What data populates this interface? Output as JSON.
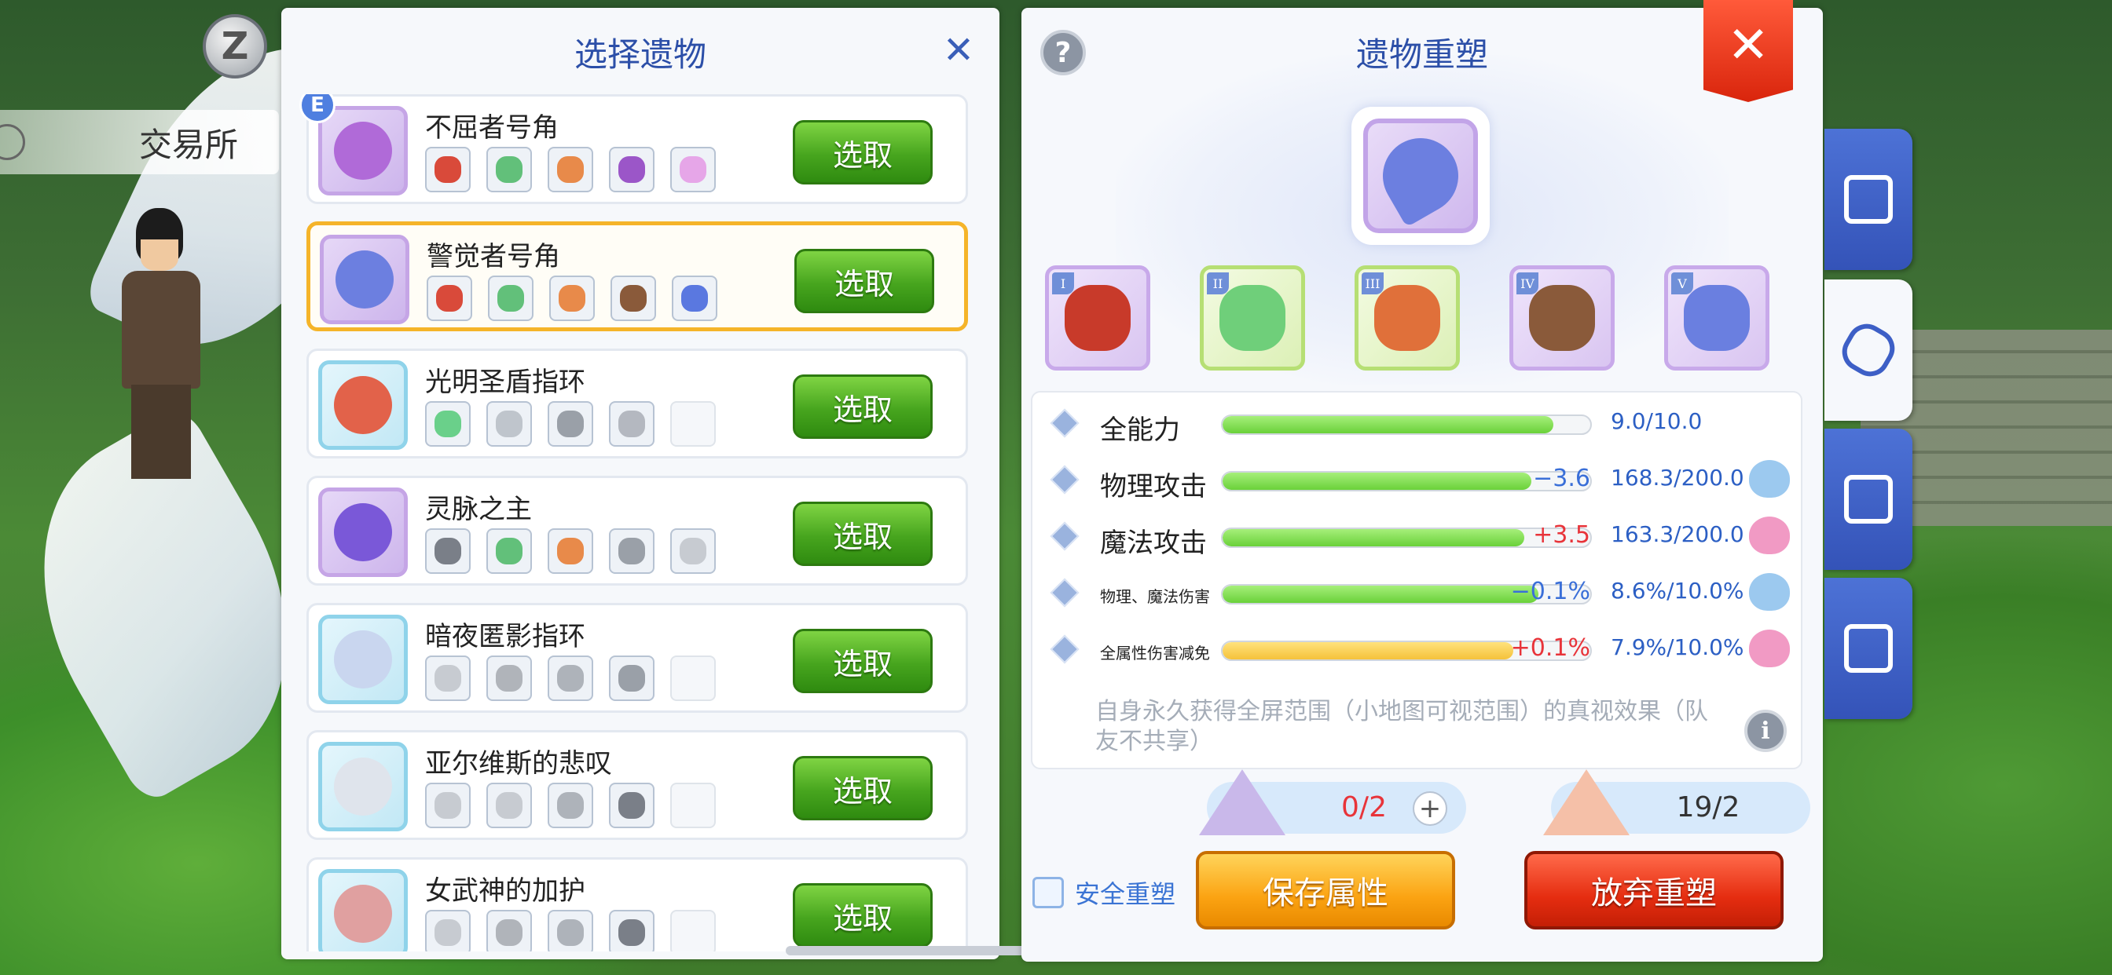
{
  "left_panel": {
    "title": "选择遗物",
    "close_icon": "close-x-icon",
    "select_label": "选取",
    "items": [
      {
        "name": "不屈者号角",
        "badge": "E",
        "frame": "purple",
        "icon_color": "#b06ad8",
        "slots": [
          "#d94a3a",
          "#62c07a",
          "#e88a4a",
          "#9b56c8",
          "#e6a6e8"
        ],
        "selected": false
      },
      {
        "name": "警觉者号角",
        "frame": "purple",
        "icon_color": "#6c7fe0",
        "slots": [
          "#d94a3a",
          "#62c07a",
          "#e88a4a",
          "#8a5a3a",
          "#5a78e0"
        ],
        "selected": true
      },
      {
        "name": "光明圣盾指环",
        "frame": "blue",
        "icon_color": "#e2624a",
        "slots": [
          "#6ad08a",
          "#bfc5cc",
          "#9aa0a8",
          "#b4b8c0",
          ""
        ],
        "selected": false
      },
      {
        "name": "灵脉之主",
        "frame": "purple",
        "icon_color": "#7a58d8",
        "slots": [
          "#7a7f88",
          "#62c07a",
          "#e88a4a",
          "#9aa0a8",
          "#c7cbd1"
        ],
        "selected": false
      },
      {
        "name": "暗夜匿影指环",
        "frame": "blue",
        "icon_color": "#c9d6ef",
        "slots": [
          "#c7cbd1",
          "#b0b4ba",
          "#aeb3ba",
          "#9aa0a8",
          ""
        ],
        "selected": false
      },
      {
        "name": "亚尔维斯的悲叹",
        "frame": "blue",
        "icon_color": "#dfe4ec",
        "slots": [
          "#c7cbd1",
          "#c7cbd1",
          "#aeb3ba",
          "#7a7f88",
          ""
        ],
        "selected": false
      },
      {
        "name": "女武神的加护",
        "frame": "blue",
        "icon_color": "#e0a0a0",
        "slots": [
          "#c7cbd1",
          "#b0b4ba",
          "#aeb3ba",
          "#7a7f88",
          ""
        ],
        "selected": false
      }
    ]
  },
  "right_panel": {
    "title": "遗物重塑",
    "help_label": "?",
    "parts": [
      {
        "roman": "I",
        "color": "#c83a2a",
        "frame": "purple"
      },
      {
        "roman": "II",
        "color": "#6fcf7a",
        "frame": "green"
      },
      {
        "roman": "III",
        "color": "#e0703a",
        "frame": "green"
      },
      {
        "roman": "IV",
        "color": "#8a5a3a",
        "frame": "purple"
      },
      {
        "roman": "V",
        "color": "#6a7fe0",
        "frame": "purple"
      }
    ],
    "stats": [
      {
        "roman": "I",
        "name": "全能力",
        "small": false,
        "fill": 0.9,
        "bar": "green",
        "delta": "",
        "delta_color": "",
        "value": "9.0/10.0",
        "poring": ""
      },
      {
        "roman": "II",
        "name": "物理攻击",
        "small": false,
        "fill": 0.84,
        "bar": "green",
        "delta": "−3.6",
        "delta_color": "#3a6fd8",
        "value": "168.3/200.0",
        "poring": "blue"
      },
      {
        "roman": "III",
        "name": "魔法攻击",
        "small": false,
        "fill": 0.82,
        "bar": "green",
        "delta": "+3.5",
        "delta_color": "#e8343a",
        "value": "163.3/200.0",
        "poring": "pink"
      },
      {
        "roman": "IV",
        "name": "物理、魔法伤害",
        "small": true,
        "fill": 0.86,
        "bar": "green",
        "delta": "−0.1%",
        "delta_color": "#3a6fd8",
        "value": "8.6%/10.0%",
        "poring": "blue"
      },
      {
        "roman": "V",
        "name": "全属性伤害减免",
        "small": true,
        "fill": 0.79,
        "bar": "yellow",
        "delta": "+0.1%",
        "delta_color": "#e8343a",
        "value": "7.9%/10.0%",
        "poring": "pink"
      }
    ],
    "description": "自身永久获得全屏范围（小地图可视范围）的真视效果（队友不共享）",
    "costs": [
      {
        "value": "0/2",
        "color": "#e8343a",
        "pile": "#c9b8ea",
        "has_plus": true
      },
      {
        "value": "19/2",
        "color": "#333333",
        "pile": "#f5c0a8",
        "has_plus": false
      }
    ],
    "plus_label": "+",
    "safe_label": "安全重塑",
    "save_label": "保存属性",
    "discard_label": "放弃重塑"
  },
  "hud": {
    "trade_label": "交易所",
    "z_label": "Z",
    "close_label": "✕"
  },
  "side_tabs": [
    {
      "icon": "shop-icon",
      "active": false
    },
    {
      "icon": "hexagon-cubes-icon",
      "active": true
    },
    {
      "icon": "molecule-icon",
      "active": false
    },
    {
      "icon": "dice-icon",
      "active": false
    }
  ]
}
